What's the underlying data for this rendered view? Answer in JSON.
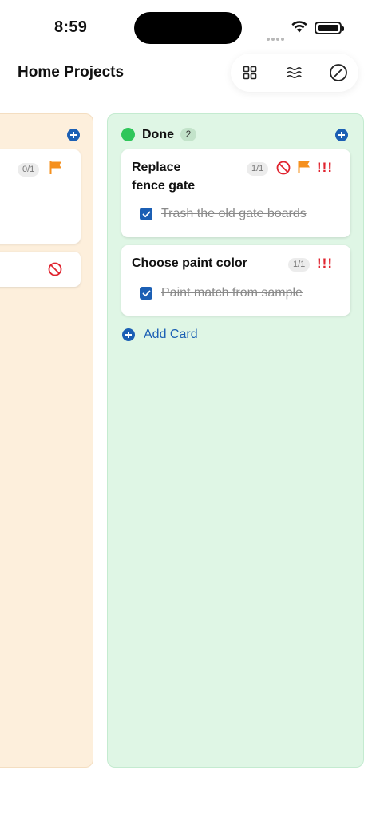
{
  "status_bar": {
    "time": "8:59"
  },
  "header": {
    "title": "Home Projects"
  },
  "toolbar": {
    "icons": [
      "grid-icon",
      "filter-waves-icon",
      "edit-icon"
    ]
  },
  "columns": [
    {
      "name": "",
      "color": "#fdefdc",
      "cards": [
        {
          "title": "",
          "progress": "0/1",
          "flag": true
        },
        {
          "title": "",
          "blocked": true
        }
      ]
    },
    {
      "name": "Done",
      "color": "#dff6e5",
      "status_color": "#2fc65a",
      "count": "2",
      "cards": [
        {
          "title_lines": [
            "Replace",
            "fence gate"
          ],
          "progress": "1/1",
          "blocked": true,
          "flag": true,
          "priority": "!!!",
          "tasks": [
            {
              "label": "Trash the old gate boards",
              "done": true
            }
          ]
        },
        {
          "title": "Choose paint color",
          "progress": "1/1",
          "priority": "!!!",
          "tasks": [
            {
              "label": "Paint match from sample",
              "done": true
            }
          ]
        }
      ],
      "add_card_label": "Add Card"
    }
  ],
  "colors": {
    "accent": "#1b5fb4",
    "flag": "#f5901e",
    "priority": "#e0242f",
    "blocked": "#e0242f"
  }
}
